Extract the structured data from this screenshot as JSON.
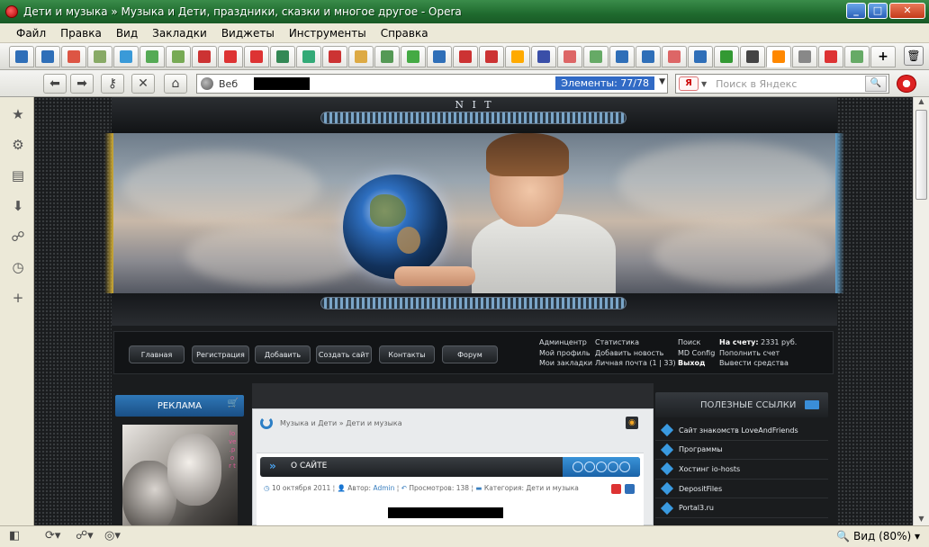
{
  "window": {
    "title": "Дети и музыка » Музыка и Дети, праздники, сказки и многое другое - Opera"
  },
  "menu": [
    "Файл",
    "Правка",
    "Вид",
    "Закладки",
    "Виджеты",
    "Инструменты",
    "Справка"
  ],
  "address": {
    "prefix": "Веб",
    "elements": "Элементы:  77/78",
    "search_placeholder": "Поиск в Яндекс",
    "search_engine": "Я"
  },
  "site": {
    "logo_text": "N I T",
    "nav": [
      "Главная",
      "Регистрация",
      "Добавить",
      "Создать сайт",
      "Контакты",
      "Форум"
    ],
    "user_links": {
      "col1": [
        "Админцентр",
        "Мой профиль",
        "Мои закладки"
      ],
      "col2": [
        "Статистика",
        "Добавить новость",
        "Личная почта (1 | 33)"
      ],
      "col3": [
        "Поиск",
        "MD Config",
        "Выход"
      ],
      "col4_label": "На счету:",
      "col4_value": "2331 руб.",
      "col4": [
        "Пополнить счет",
        "Вывести средства"
      ]
    },
    "left_block": {
      "title": "РЕКЛАМА",
      "vertical_text": "lo ve .p o r t"
    },
    "breadcrumb": "Музыка и Дети » Дети и музыка",
    "article": {
      "title": "О САЙТЕ",
      "date": "10 октября 2011",
      "author_label": "Автор:",
      "author": "Admin",
      "views_label": "Просмотров:",
      "views": "138",
      "category_label": "Категория:",
      "category": "Дети и музыка"
    },
    "right_block": {
      "title": "ПОЛЕЗНЫЕ ССЫЛКИ",
      "links": [
        "Сайт знакомств LoveAndFriends",
        "Программы",
        "Хостинг io-hosts",
        "DepositFiles",
        "Portal3.ru"
      ]
    }
  },
  "status": {
    "zoom": "Вид (80%)"
  },
  "colors": {
    "title_green": "#1f6a2e",
    "accent_blue": "#2f78b8",
    "site_bg": "#1a1c1e"
  }
}
